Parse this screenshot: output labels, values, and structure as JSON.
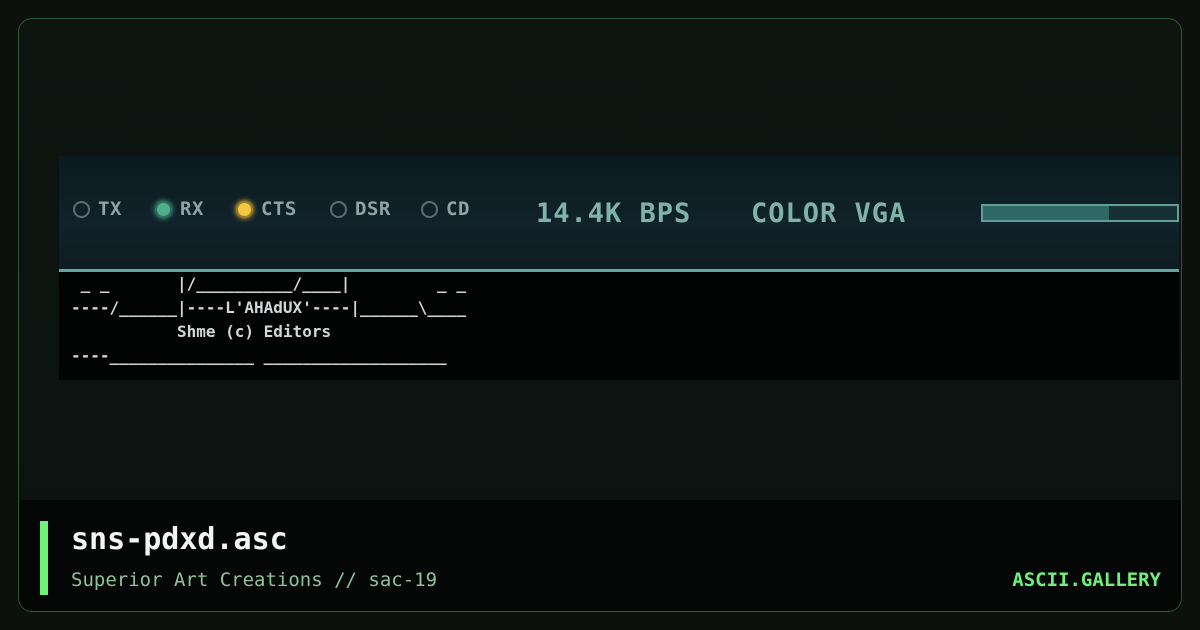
{
  "card": {
    "filename": "sns-pdxd.asc",
    "subtitle": "Superior Art Creations // sac-19",
    "brand": "ASCII.GALLERY",
    "accent_color": "#6ef07a"
  },
  "status": {
    "indicators": [
      {
        "label": "TX",
        "state": "off"
      },
      {
        "label": "RX",
        "state": "on",
        "color": "#4fae8c"
      },
      {
        "label": "CTS",
        "state": "on",
        "color": "#f3c844"
      },
      {
        "label": "DSR",
        "state": "off"
      },
      {
        "label": "CD",
        "state": "off"
      }
    ],
    "speed": "14.4K BPS",
    "mode": "COLOR VGA",
    "progress": 0.65
  },
  "ascii_art": " _ _       |/__________/____|         _ _\n----/______|----L'AHAdUX'----|______\\____\n           Shme (c) Editors\n----_______________ ___________________"
}
